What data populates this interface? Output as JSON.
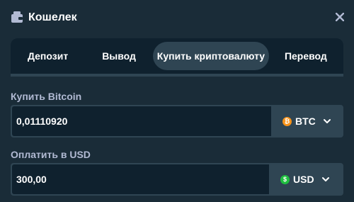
{
  "header": {
    "title": "Кошелек"
  },
  "tabs": [
    {
      "label": "Депозит",
      "active": false
    },
    {
      "label": "Вывод",
      "active": false
    },
    {
      "label": "Купить криптовалюту",
      "active": true
    },
    {
      "label": "Перевод",
      "active": false
    }
  ],
  "buy": {
    "label": "Купить Bitcoin",
    "value": "0,01110920",
    "currency": "BTC",
    "coin_symbol": "₿",
    "coin_color": "#f7931a"
  },
  "pay": {
    "label": "Оплатить в USD",
    "value": "300,00",
    "currency": "USD",
    "coin_symbol": "$",
    "coin_color": "#1fbf3f"
  },
  "colors": {
    "background": "#1a2c38",
    "panel_dark": "#0f212e",
    "panel_mid": "#2f4553",
    "label_text": "#b1bad3"
  }
}
